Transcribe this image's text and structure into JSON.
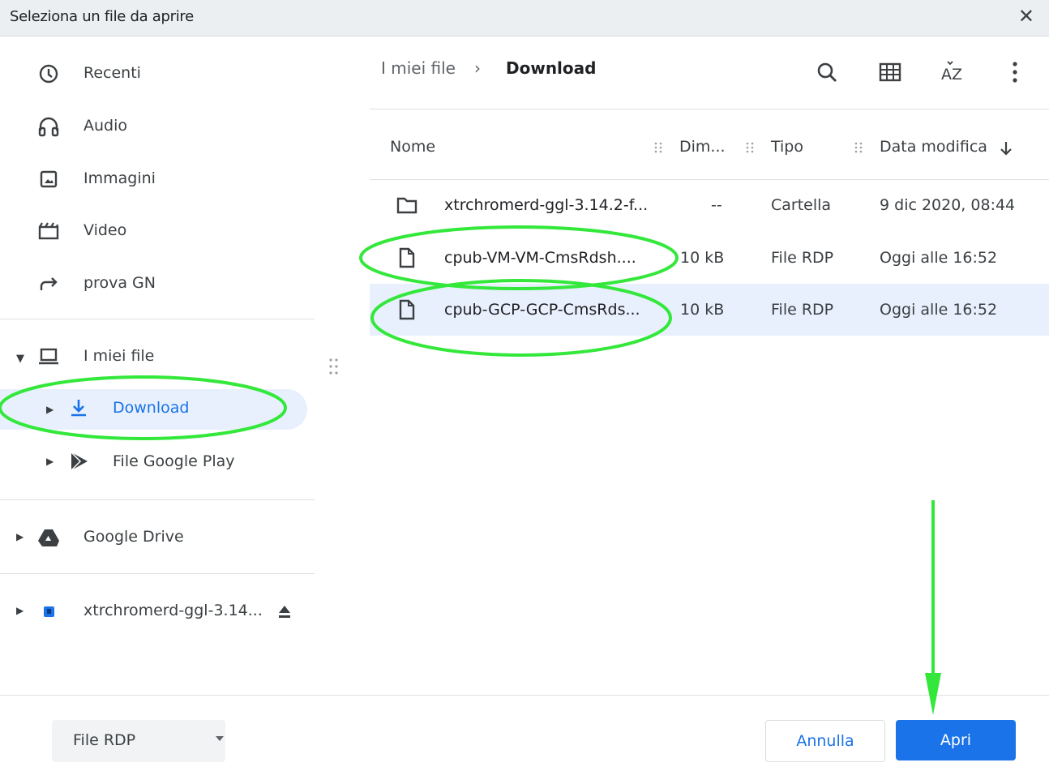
{
  "dialog": {
    "title": "Seleziona un file da aprire"
  },
  "sidebar": {
    "items": [
      {
        "label": "Recenti",
        "icon": "clock-icon"
      },
      {
        "label": "Audio",
        "icon": "headphones-icon"
      },
      {
        "label": "Immagini",
        "icon": "image-icon"
      },
      {
        "label": "Video",
        "icon": "film-icon"
      },
      {
        "label": "prova GN",
        "icon": "share-arrow-icon"
      }
    ],
    "my_files": {
      "label": "I miei file",
      "icon": "laptop-icon",
      "expanded": true
    },
    "download": {
      "label": "Download",
      "icon": "download-icon",
      "selected": true
    },
    "google_play": {
      "label": "File Google Play",
      "icon": "play-store-icon"
    },
    "google_drive": {
      "label": "Google Drive",
      "icon": "google-drive-icon"
    },
    "removable": {
      "label": "xtrchromerd-ggl-3.14...",
      "icon": "usb-drive-icon",
      "eject_icon": "eject-icon"
    }
  },
  "breadcrumb": {
    "root": "I miei file",
    "separator": "›",
    "current": "Download"
  },
  "toolbar": {
    "icons": [
      "search-icon",
      "grid-view-icon",
      "sort-az-icon",
      "more-vert-icon"
    ]
  },
  "columns": {
    "name": "Nome",
    "size": "Dim...",
    "type": "Tipo",
    "date": "Data modifica"
  },
  "files": [
    {
      "name": "xtrchromerd-ggl-3.14.2-f...",
      "size": "--",
      "type": "Cartella",
      "date": "9 dic 2020, 08:44",
      "icon": "folder-icon",
      "selected": false
    },
    {
      "name": "cpub-VM-VM-CmsRdsh....",
      "size": "10 kB",
      "type": "File RDP",
      "date": "Oggi alle 16:52",
      "icon": "file-icon",
      "selected": false
    },
    {
      "name": "cpub-GCP-GCP-CmsRds...",
      "size": "10 kB",
      "type": "File RDP",
      "date": "Oggi alle 16:52",
      "icon": "file-icon",
      "selected": true
    }
  ],
  "footer": {
    "filter": {
      "selected": "File RDP"
    },
    "cancel_label": "Annulla",
    "open_label": "Apri"
  },
  "colors": {
    "accent": "#1a73e8",
    "selected_bg": "#e8f0fe",
    "annotation": "#33e83a"
  }
}
